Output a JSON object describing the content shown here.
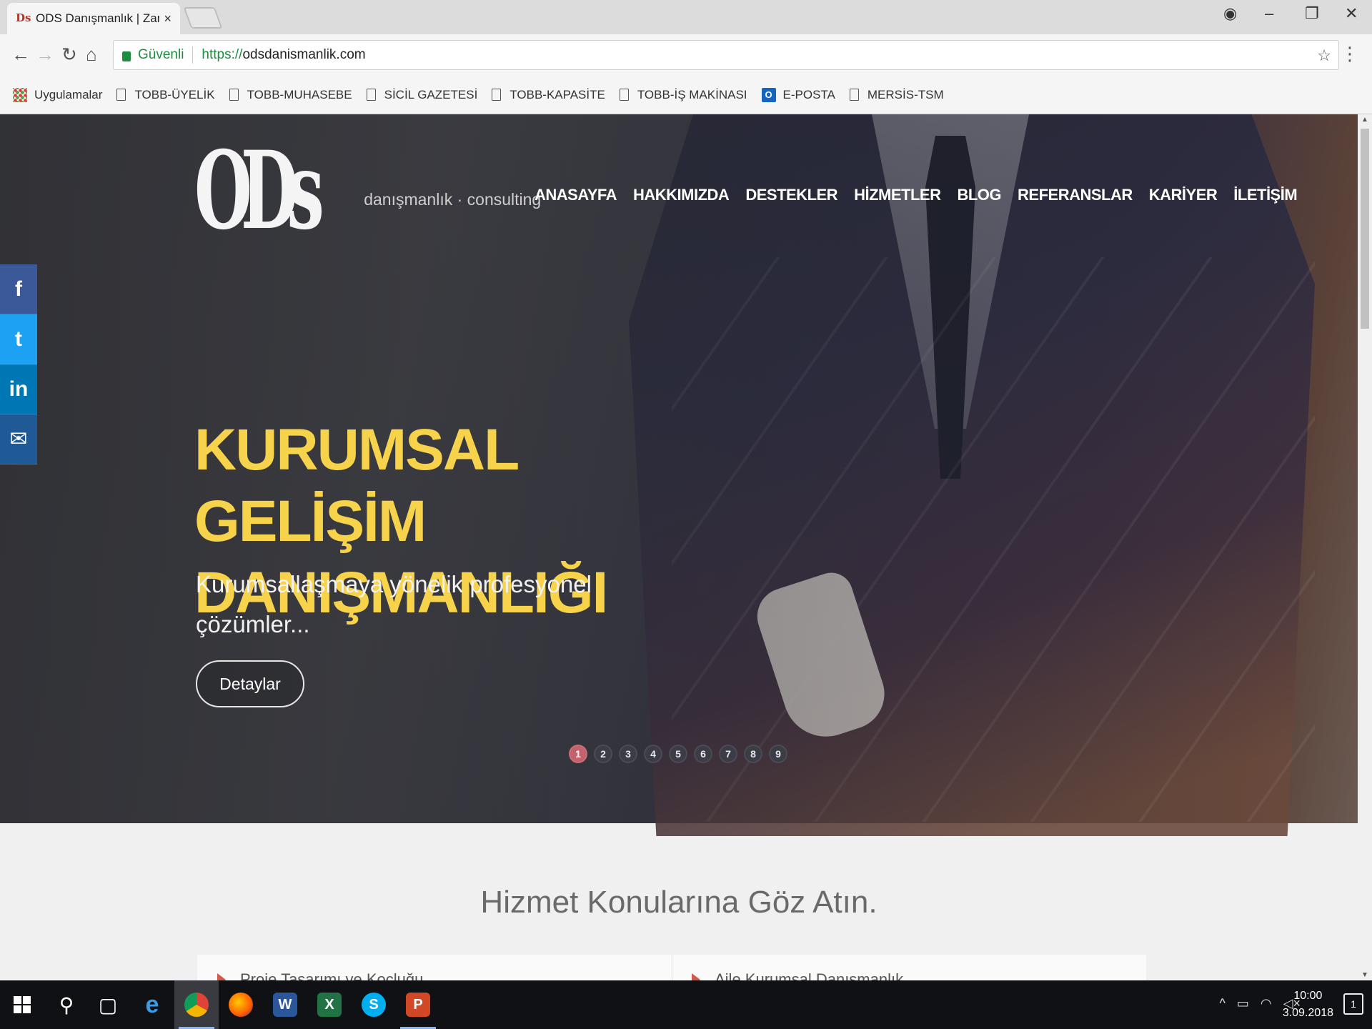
{
  "browser": {
    "tab_title": "ODS Danışmanlık | Zaman",
    "tab_close": "×",
    "secure_label": "Güvenli",
    "url_scheme": "https://",
    "url_host": "odsdanismanlik.com",
    "bookmarks": [
      "Uygulamalar",
      "TOBB-ÜYELİK",
      "TOBB-MUHASEBE",
      "SİCİL GAZETESİ",
      "TOBB-KAPASİTE",
      "TOBB-İŞ MAKİNASI",
      "E-POSTA",
      "MERSİS-TSM"
    ],
    "icons": [
      "back-icon",
      "forward-icon",
      "reload-icon",
      "home-icon",
      "lock-icon",
      "star-icon",
      "menu-icon",
      "profile-icon",
      "minimize-icon",
      "maximize-icon",
      "close-icon"
    ]
  },
  "site": {
    "logo_mark": "ODs",
    "logo_text": "danışmanlık · consulting",
    "nav": [
      "ANASAYFA",
      "HAKKIMIZDA",
      "DESTEKLER",
      "HİZMETLER",
      "BLOG",
      "REFERANSLAR",
      "KARİYER",
      "İLETİŞİM"
    ],
    "social": [
      "f",
      "t",
      "in",
      "✉"
    ],
    "hero": {
      "title_line1": "KURUMSAL GELİŞİM",
      "title_line2": "DANIŞMANLIĞI",
      "subtitle": "Kurumsallaşmaya yönelik profesyonel çözümler...",
      "button": "Detaylar",
      "title_color": "#f6d34a"
    },
    "slider_dots": [
      "1",
      "2",
      "3",
      "4",
      "5",
      "6",
      "7",
      "8",
      "9"
    ],
    "slider_active": 1,
    "section_title": "Hizmet Konularına Göz Atın.",
    "cards": [
      "Proje Tasarımı ve Koçluğu",
      "Aile Kurumsal Danışmanlık"
    ]
  },
  "taskbar": {
    "apps": [
      "windows-start",
      "search",
      "task-view",
      "edge",
      "chrome",
      "firefox",
      "word",
      "excel",
      "skype",
      "powerpoint"
    ],
    "time": "10:00",
    "date": "3.09.2018",
    "notifications": "1"
  }
}
